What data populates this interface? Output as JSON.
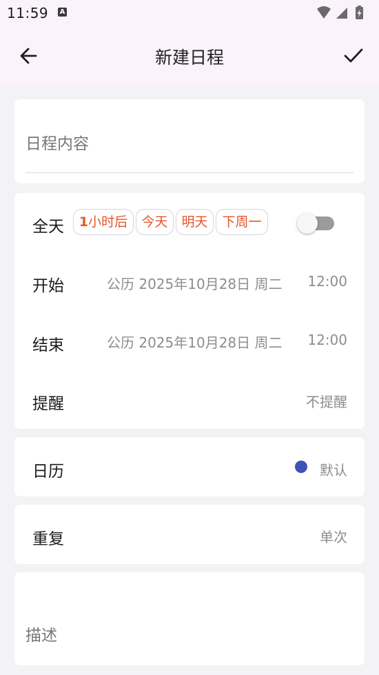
{
  "status_bar": {
    "time": "11:59",
    "notification_letter": "A",
    "icons": [
      "wifi-icon",
      "signal-icon",
      "battery-charging-icon"
    ]
  },
  "app_bar": {
    "title": "新建日程",
    "back_icon": "arrow-left-icon",
    "confirm_icon": "check-icon"
  },
  "content": {
    "placeholder": "日程内容",
    "value": ""
  },
  "all_day": {
    "label": "全天",
    "quick_chips": [
      "1小时后",
      "今天",
      "明天",
      "下周一"
    ],
    "toggle_on": false,
    "chip_text_color": "#e6542a"
  },
  "start": {
    "label": "开始",
    "date": "公历 2025年10月28日 周二",
    "time": "12:00"
  },
  "end": {
    "label": "结束",
    "date": "公历 2025年10月28日 周二",
    "time": "12:00"
  },
  "reminder": {
    "label": "提醒",
    "value": "不提醒"
  },
  "calendar": {
    "label": "日历",
    "value": "默认",
    "color": "#3f51b5"
  },
  "repeat": {
    "label": "重复",
    "value": "单次"
  },
  "description": {
    "placeholder": "描述",
    "value": ""
  }
}
